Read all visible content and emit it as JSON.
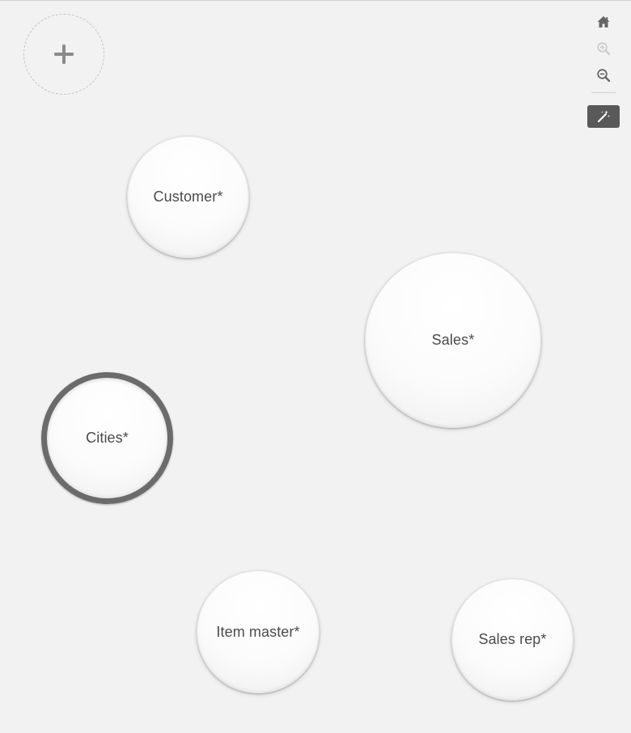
{
  "add_button": {
    "icon": "plus-icon"
  },
  "tables": [
    {
      "label": "Customer*"
    },
    {
      "label": "Sales*"
    },
    {
      "label": "Cities*",
      "selected": true
    },
    {
      "label": "Item master*"
    },
    {
      "label": "Sales rep*"
    }
  ],
  "toolbar": {
    "home": {
      "icon": "home-icon"
    },
    "zoom_in": {
      "icon": "zoom-in-icon",
      "enabled": false
    },
    "zoom_out": {
      "icon": "zoom-out-icon"
    },
    "magic_wand": {
      "icon": "magic-wand-icon"
    }
  },
  "colors": {
    "background": "#f2f2f2",
    "bubble_text": "#4a4a4a",
    "selected_ring": "#6b6b6b",
    "icon": "#666666",
    "icon_disabled": "#cccccc",
    "magic_button_bg": "#595959"
  }
}
